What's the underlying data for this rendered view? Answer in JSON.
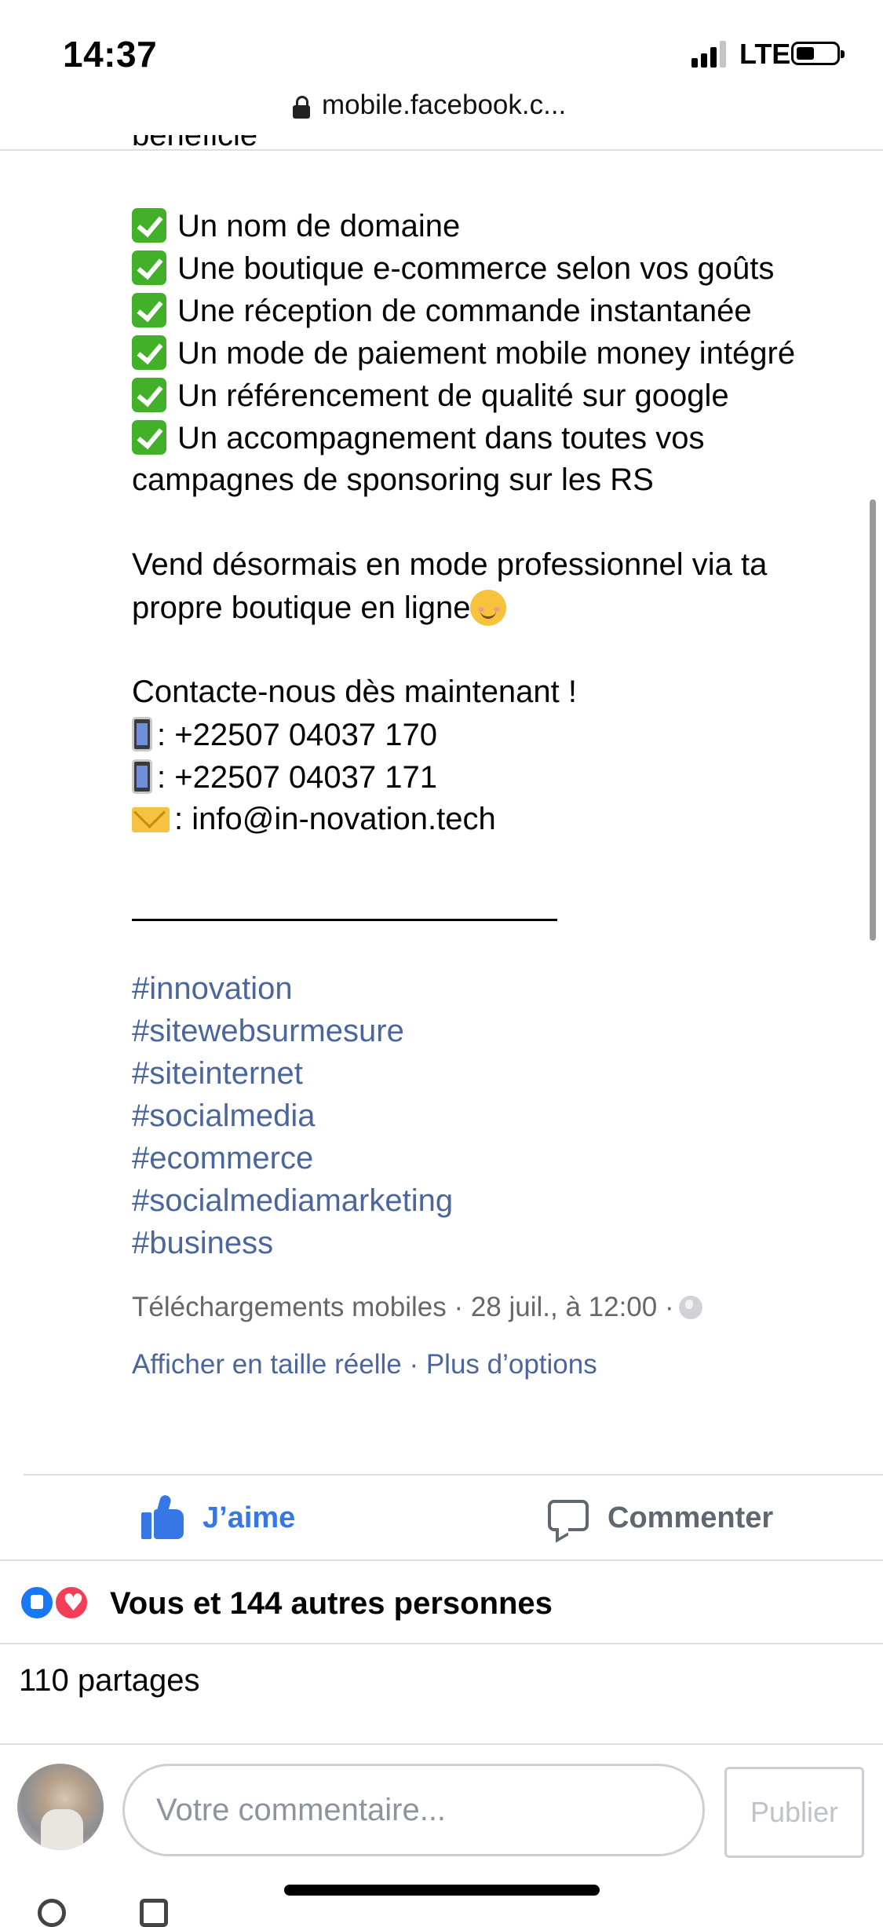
{
  "status_bar": {
    "time": "14:37",
    "network": "LTE"
  },
  "browser": {
    "url": "mobile.facebook.c..."
  },
  "post": {
    "cut_text": "bénéficie",
    "features": [
      "Un nom de domaine",
      "Une boutique e-commerce selon vos goûts",
      "Une réception de commande instantanée",
      "Un mode de paiement mobile money intégré",
      "Un référencement de qualité sur google",
      "Un accompagnement dans toutes vos"
    ],
    "feature_continuation": "campagnes de sponsoring sur les RS",
    "pitch_line1": "Vend désormais en mode professionnel via ta",
    "pitch_line2": "propre boutique en ligne",
    "contact_heading": "Contacte-nous dès maintenant !",
    "phone1": ": +22507 04037 170",
    "phone2": ": +22507 04037 171",
    "email": ": info@in-novation.tech",
    "hashtags": [
      "#innovation",
      "#sitewebsurmesure",
      "#siteinternet",
      "#socialmedia",
      "#ecommerce",
      "#socialmediamarketing",
      "#business"
    ],
    "meta_line": "Téléchargements mobiles · 28 juil., à 12:00 ·",
    "full_size_link": "Afficher en taille réelle",
    "meta_sep": " · ",
    "more_options_link": "Plus d’options"
  },
  "actions": {
    "like_label": "J’aime",
    "comment_label": "Commenter"
  },
  "reactions": {
    "summary": "Vous et 144 autres personnes"
  },
  "shares": "110 partages",
  "composer": {
    "placeholder": "Votre commentaire...",
    "publish_label": "Publier"
  },
  "colors": {
    "accent": "#3578e5",
    "hashtag": "#4b669c",
    "love": "#f33e58",
    "check": "#43b02a"
  }
}
